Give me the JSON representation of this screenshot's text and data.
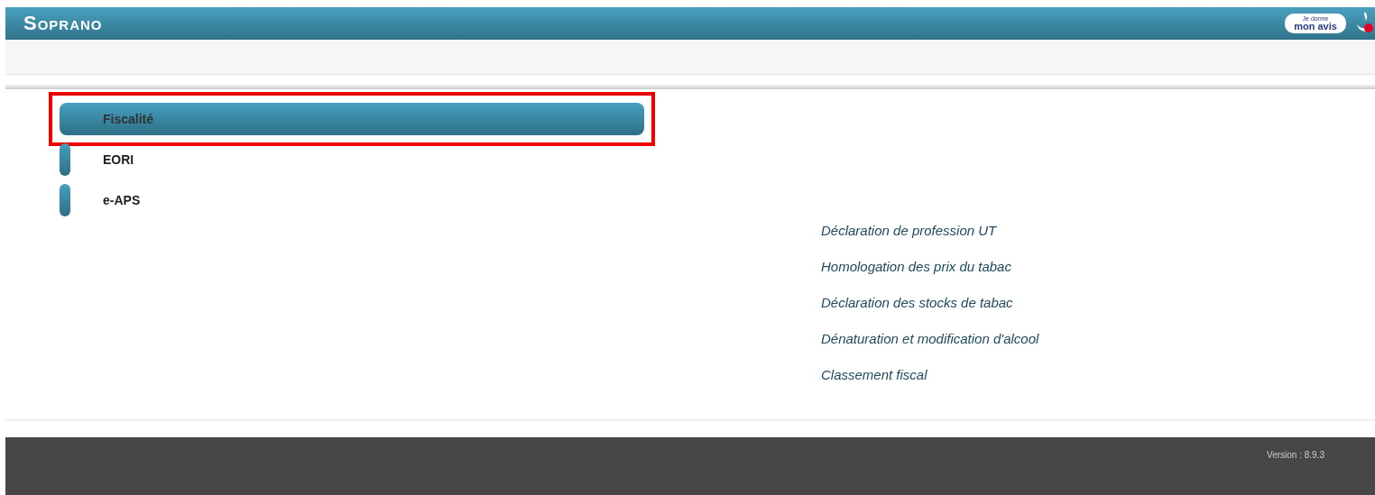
{
  "header": {
    "title": "Soprano",
    "feedback_badge": {
      "line_1": "Je donne",
      "line_2": "mon avis"
    }
  },
  "menu": [
    {
      "label": "Fiscalité",
      "selected": true,
      "highlighted": true
    },
    {
      "label": "EORI",
      "selected": false,
      "highlighted": false
    },
    {
      "label": "e-APS",
      "selected": false,
      "highlighted": false
    }
  ],
  "links": [
    "Déclaration de profession UT",
    "Homologation des prix du tabac",
    "Déclaration des stocks de tabac",
    "Dénaturation et modification d'alcool",
    "Classement fiscal"
  ],
  "footer": {
    "version": "Version : 8.9.3"
  }
}
